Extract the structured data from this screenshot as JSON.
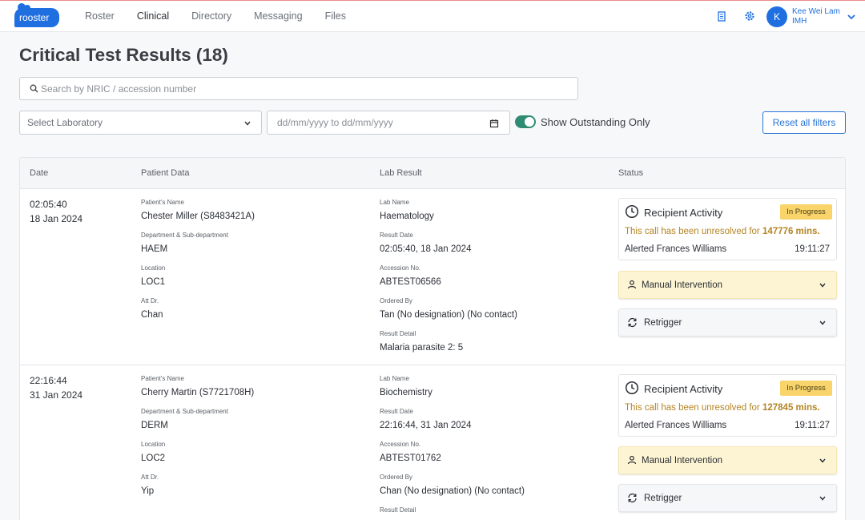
{
  "brand": {
    "logo_text": "rooster",
    "accent": "#1f6fe0"
  },
  "nav": {
    "items": [
      {
        "label": "Roster",
        "active": false
      },
      {
        "label": "Clinical",
        "active": true
      },
      {
        "label": "Directory",
        "active": false
      },
      {
        "label": "Messaging",
        "active": false
      },
      {
        "label": "Files",
        "active": false
      }
    ]
  },
  "user": {
    "initial": "K",
    "name": "Kee Wei Lam",
    "org": "IMH"
  },
  "page": {
    "title": "Critical Test Results (18)"
  },
  "search": {
    "placeholder": "Search by NRIC / accession number",
    "value": ""
  },
  "filters": {
    "laboratory_placeholder": "Select Laboratory",
    "date_placeholder": "dd/mm/yyyy to dd/mm/yyyy",
    "outstanding_label": "Show Outstanding Only",
    "outstanding_on": true,
    "reset_label": "Reset all filters"
  },
  "table": {
    "headers": {
      "date": "Date",
      "patient": "Patient Data",
      "lab": "Lab Result",
      "status": "Status"
    },
    "captions": {
      "patient_name": "Patient's Name",
      "department": "Department & Sub-department",
      "location": "Location",
      "att_dr": "Att Dr.",
      "lab_name": "Lab Name",
      "result_date": "Result Date",
      "accession": "Accession No.",
      "ordered_by": "Ordered By",
      "result_detail": "Result Detail"
    },
    "status_labels": {
      "recipient_activity": "Recipient Activity",
      "unresolved_prefix": "This call has been unresolved for",
      "manual_intervention": "Manual Intervention",
      "retrigger": "Retrigger"
    },
    "rows": [
      {
        "time": "02:05:40",
        "date": "18 Jan 2024",
        "patient_name": "Chester Miller (S8483421A)",
        "department": "HAEM",
        "location": "LOC1",
        "att_dr": "Chan",
        "lab_name": "Haematology",
        "result_date": "02:05:40, 18 Jan 2024",
        "accession": "ABTEST06566",
        "ordered_by": "Tan (No designation) (No contact)",
        "result_detail": "Malaria parasite 2: 5",
        "status_badge": "In Progress",
        "unresolved_mins": "147776 mins.",
        "alerted": "Alerted Frances Williams",
        "alerted_time": "19:11:27"
      },
      {
        "time": "22:16:44",
        "date": "31 Jan 2024",
        "patient_name": "Cherry Martin (S7721708H)",
        "department": "DERM",
        "location": "LOC2",
        "att_dr": "Yip",
        "lab_name": "Biochemistry",
        "result_date": "22:16:44, 31 Jan 2024",
        "accession": "ABTEST01762",
        "ordered_by": "Chan (No designation) (No contact)",
        "result_detail": "",
        "status_badge": "In Progress",
        "unresolved_mins": "127845 mins.",
        "alerted": "Alerted Frances Williams",
        "alerted_time": "19:11:27"
      }
    ]
  },
  "colors": {
    "toggle_on": "#2f8c72",
    "badge": "#f8d46a",
    "warning_text": "#b38422",
    "manual_bg": "#fdf4d3"
  }
}
